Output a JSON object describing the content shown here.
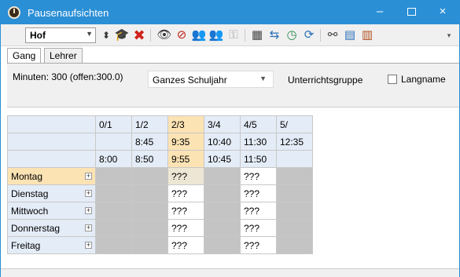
{
  "window": {
    "title": "Pausenaufsichten",
    "minimize": "–",
    "close": "×"
  },
  "toolbar": {
    "location": "Hof",
    "icons": [
      "up-down-stepper",
      "hat",
      "delete-red-x",
      "eye",
      "eye-crossed",
      "people",
      "people-gray",
      "key-gray",
      "calculator",
      "chart-bar",
      "clock",
      "refresh",
      "binoculars",
      "calendar",
      "library"
    ]
  },
  "tabs": [
    {
      "label": "Gang",
      "active": true
    },
    {
      "label": "Lehrer",
      "active": false
    }
  ],
  "info": {
    "minutes": "Minuten: 300 (offen:300.0)",
    "period": "Ganzes Schuljahr",
    "group_label": "Unterrichtsgruppe",
    "langname_label": "Langname",
    "langname_checked": false
  },
  "grid": {
    "columns": [
      {
        "slot": "",
        "start": "",
        "end": ""
      },
      {
        "slot": "0/1",
        "start": "",
        "end": "8:00"
      },
      {
        "slot": "1/2",
        "start": "8:45",
        "end": "8:50"
      },
      {
        "slot": "2/3",
        "start": "9:35",
        "end": "9:55",
        "highlight": true
      },
      {
        "slot": "3/4",
        "start": "10:40",
        "end": "10:45"
      },
      {
        "slot": "4/5",
        "start": "11:30",
        "end": "11:50"
      },
      {
        "slot": "5/",
        "start": "12:35",
        "end": ""
      }
    ],
    "rows": [
      {
        "day": "Montag",
        "highlight": true,
        "cells": [
          "",
          "",
          "???",
          "",
          "???",
          ""
        ]
      },
      {
        "day": "Dienstag",
        "cells": [
          "",
          "",
          "???",
          "",
          "???",
          ""
        ]
      },
      {
        "day": "Mittwoch",
        "cells": [
          "",
          "",
          "???",
          "",
          "???",
          ""
        ]
      },
      {
        "day": "Donnerstag",
        "cells": [
          "",
          "",
          "???",
          "",
          "???",
          ""
        ]
      },
      {
        "day": "Freitag",
        "cells": [
          "",
          "",
          "???",
          "",
          "???",
          ""
        ]
      }
    ],
    "expand_glyph": "+",
    "colors": {
      "header_bg": "#e4ecf7",
      "highlight_bg": "#fce3b4",
      "empty_cell": "#c4c4c4",
      "active_cell": "#ffffff",
      "selected_cell": "#ede6d4"
    }
  }
}
